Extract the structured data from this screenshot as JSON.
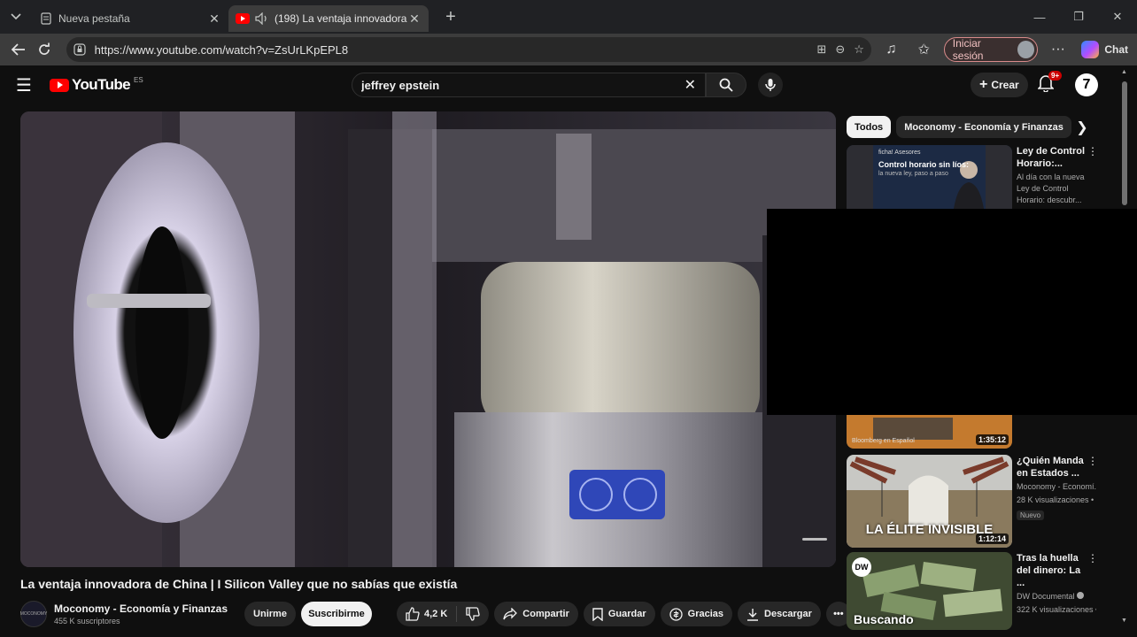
{
  "browser": {
    "tabs": [
      {
        "title": "Nueva pestaña",
        "active": false
      },
      {
        "title": "(198) La ventaja innovadora de China | I Silicon Valley que no sabías que existía",
        "active": true
      }
    ],
    "url": "https://www.youtube.com/watch?v=ZsUrLKpEPL8",
    "signin_label": "Iniciar sesión",
    "chat_label": "Chat"
  },
  "youtube": {
    "logo_text": "YouTube",
    "country_code": "ES",
    "search_value": "jeffrey epstein",
    "create_label": "Crear",
    "notification_badge": "9+",
    "accent_color": "#ff0000"
  },
  "video": {
    "title": "La ventaja innovadora de China | I Silicon Valley que no sabías que existía",
    "channel": "Moconomy - Economía y Finanzas",
    "channel_avatar_text": "MOCONOMY",
    "subscribers": "455 K suscriptores",
    "join_label": "Unirme",
    "subscribe_label": "Suscribirme",
    "likes": "4,2 K",
    "share_label": "Compartir",
    "save_label": "Guardar",
    "thanks_label": "Gracias",
    "download_label": "Descargar"
  },
  "chips": [
    {
      "label": "Todos",
      "active": true
    },
    {
      "label": "Moconomy - Economía y Finanzas",
      "active": false
    }
  ],
  "recommendations": [
    {
      "title": "Ley de Control Horario:...",
      "description": "Al día con la nueva Ley de Control Horario: descubr...",
      "thumb_text_small": "Control horario sin líos:",
      "thumb_text_sub": "la nueva ley, paso a paso",
      "thumb_brand": "ficha! Asesores"
    },
    {
      "duration": "1:35:12",
      "thumb_channel": "Bloomberg en Español"
    },
    {
      "title": "¿Quién Manda en Estados ...",
      "channel": "Moconomy - Economí...",
      "views": "28 K visualizaciones • h",
      "badge": "Nuevo",
      "duration": "1:12:14",
      "thumb_text": "LA ÉLITE INVISIBLE"
    },
    {
      "title": "Tras la huella del dinero: La ...",
      "channel": "DW Documental",
      "views": "322 K visualizaciones •",
      "thumb_text": "Buscando",
      "thumb_logo": "DW"
    }
  ]
}
